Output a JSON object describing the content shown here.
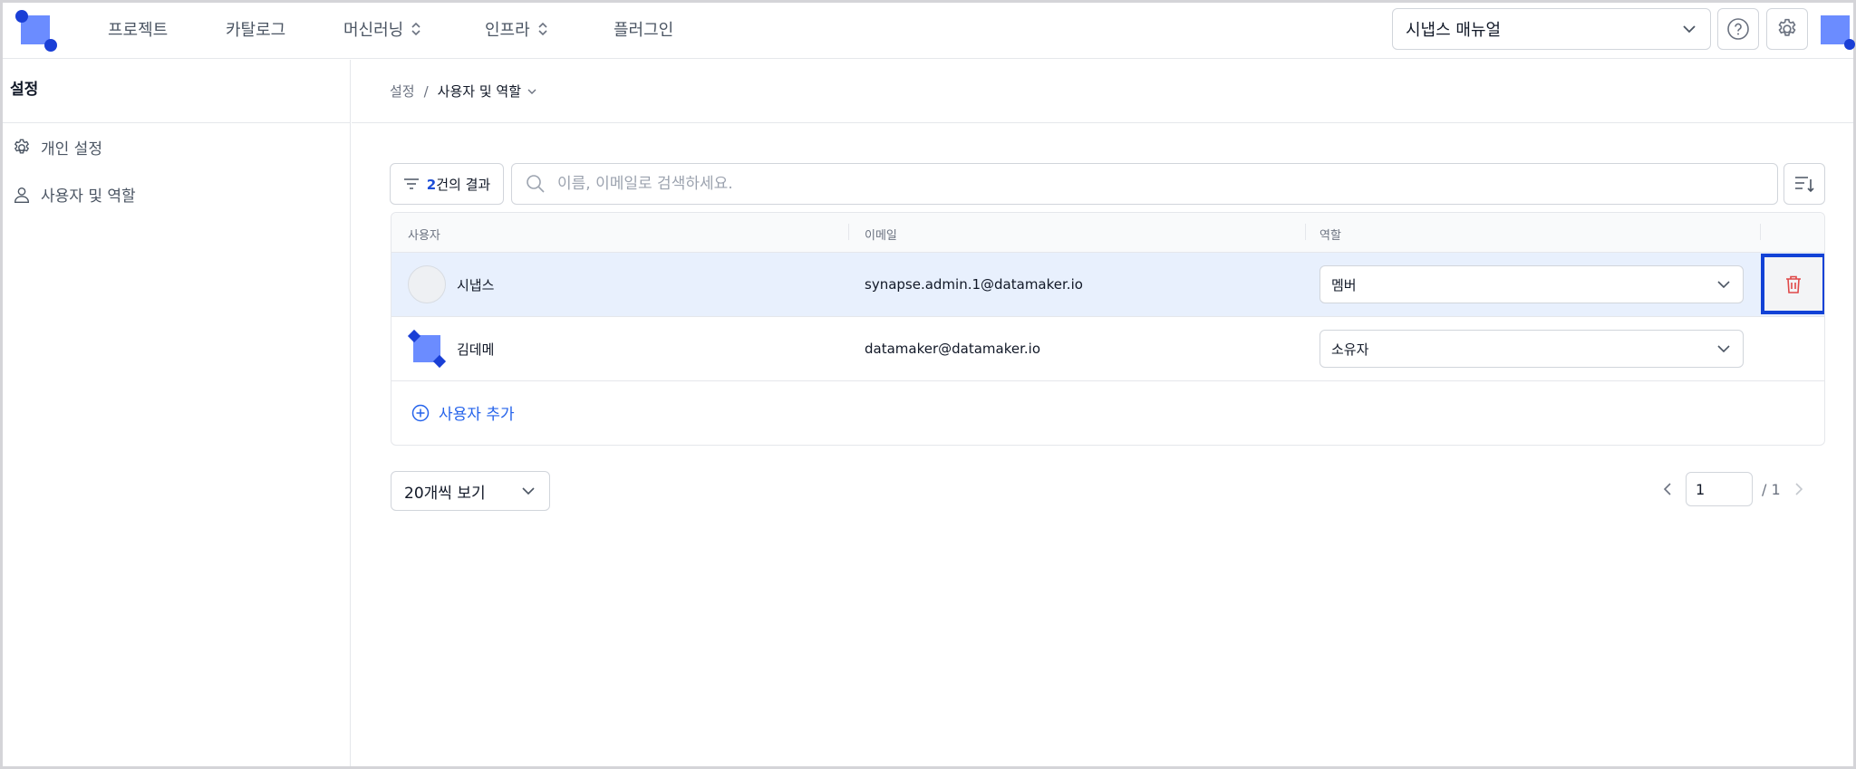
{
  "topbar": {
    "nav": [
      {
        "label": "프로젝트"
      },
      {
        "label": "카탈로그"
      },
      {
        "label": "머신러닝"
      },
      {
        "label": "인프라"
      },
      {
        "label": "플러그인"
      }
    ],
    "manual_select": "시냅스 매뉴얼"
  },
  "sidebar": {
    "title": "설정",
    "items": [
      {
        "label": "개인 설정",
        "icon": "gear-icon"
      },
      {
        "label": "사용자 및 역할",
        "icon": "user-icon"
      }
    ]
  },
  "breadcrumb": {
    "parent": "설정",
    "separator": "/",
    "current": "사용자 및 역할"
  },
  "toolbar": {
    "result_count": "2",
    "result_suffix": "건의 결과",
    "search_placeholder": "이름, 이메일로 검색하세요."
  },
  "table": {
    "headers": [
      "사용자",
      "이메일",
      "역할"
    ],
    "rows": [
      {
        "name": "시냅스",
        "email": "synapse.admin.1@datamaker.io",
        "role": "멤버"
      },
      {
        "name": "김데메",
        "email": "datamaker@datamaker.io",
        "role": "소유자"
      }
    ],
    "add_user_label": "사용자 추가"
  },
  "pagination": {
    "page_size_label": "20개씩 보기",
    "current_page": "1",
    "total_pages": "/ 1"
  },
  "colors": {
    "accent": "#2563eb",
    "selected_row": "#e8f0fd",
    "highlight_border": "#1242d6",
    "delete_red": "#e04848"
  }
}
